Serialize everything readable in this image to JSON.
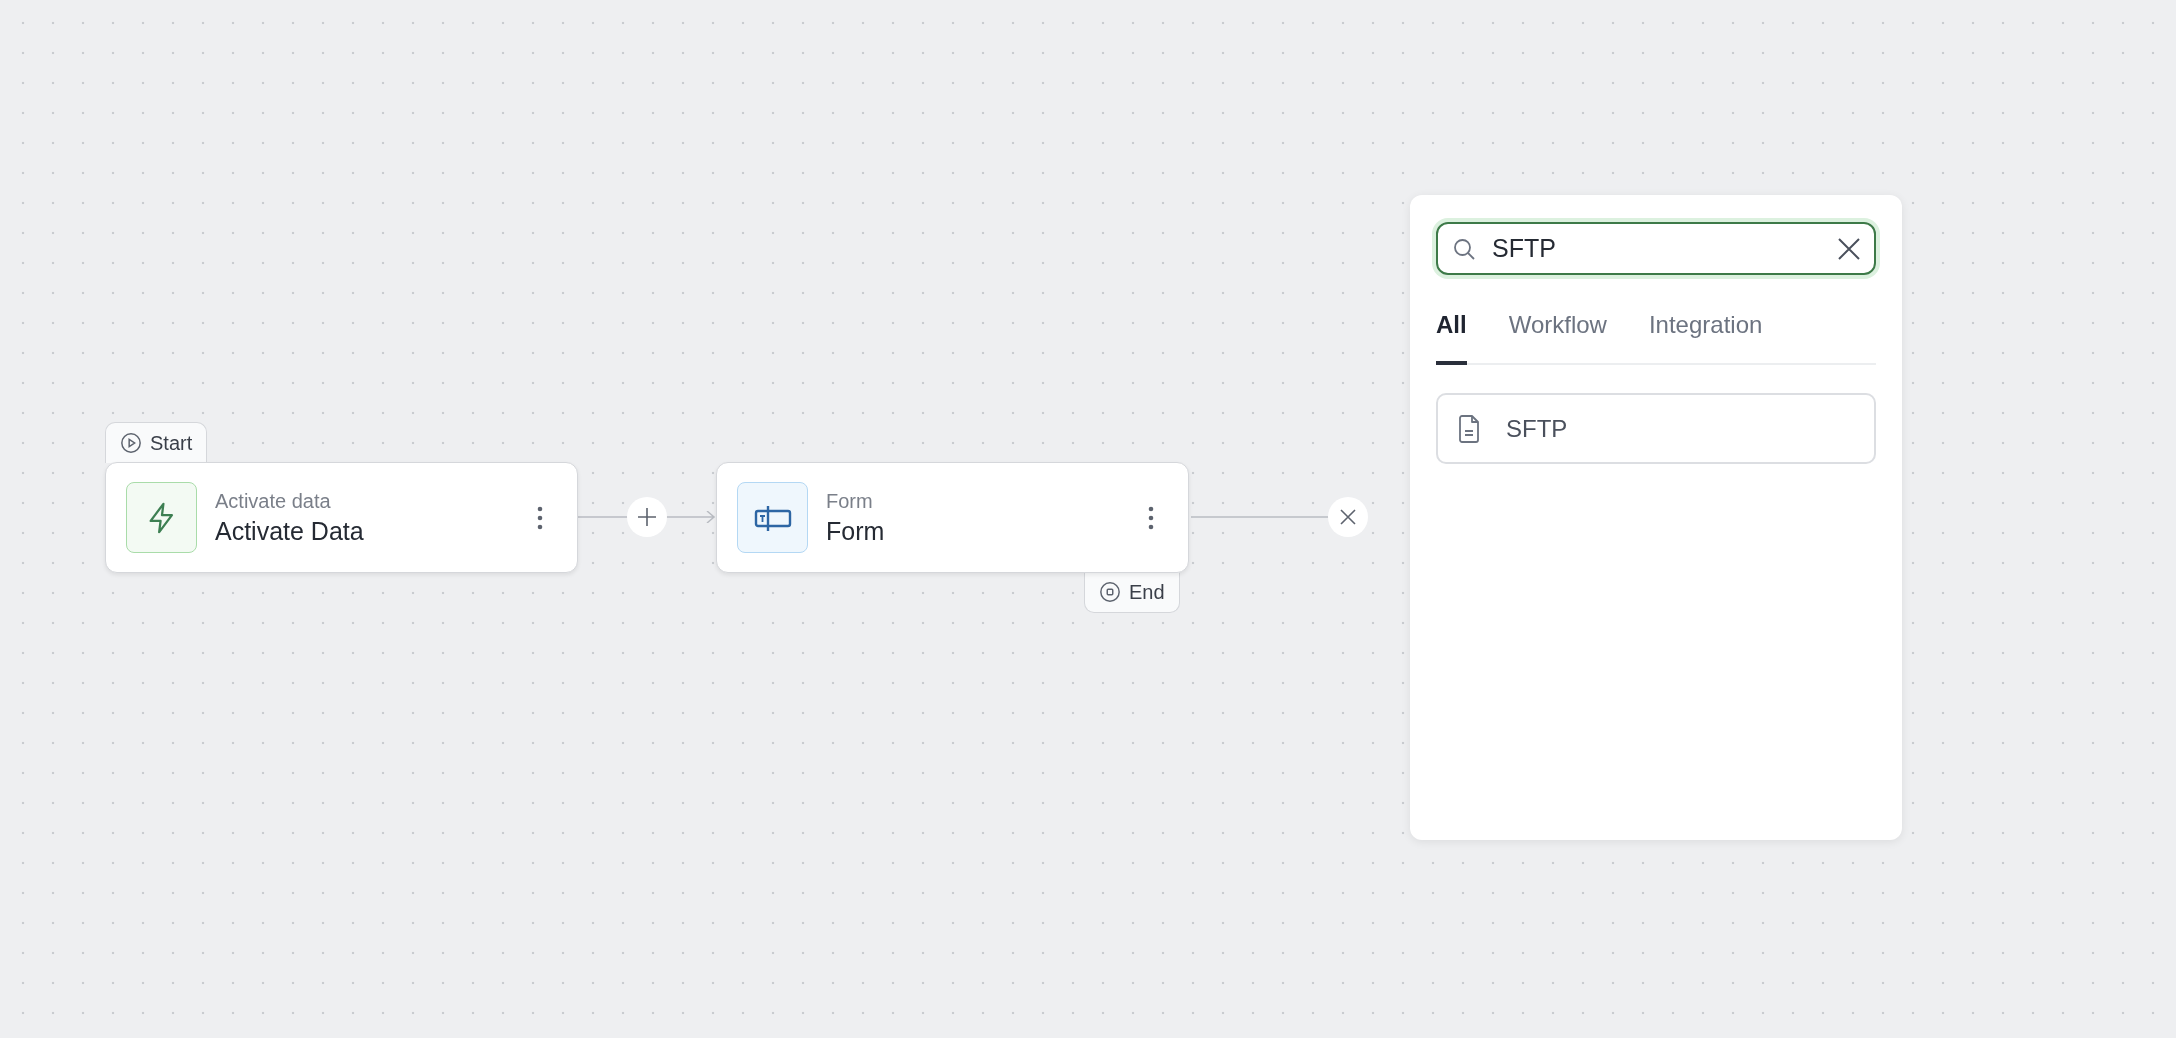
{
  "canvas": {
    "nodes": [
      {
        "kind": "trigger",
        "badge": {
          "kind": "start",
          "label": "Start"
        },
        "subtitle": "Activate data",
        "title": "Activate Data"
      },
      {
        "kind": "form",
        "badge": {
          "kind": "end",
          "label": "End"
        },
        "subtitle": "Form",
        "title": "Form"
      }
    ]
  },
  "picker": {
    "search": {
      "value": "SFTP"
    },
    "tabs": [
      {
        "label": "All",
        "selected": true
      },
      {
        "label": "Workflow",
        "selected": false
      },
      {
        "label": "Integration",
        "selected": false
      }
    ],
    "results": [
      {
        "kind": "file",
        "label": "SFTP"
      }
    ]
  }
}
